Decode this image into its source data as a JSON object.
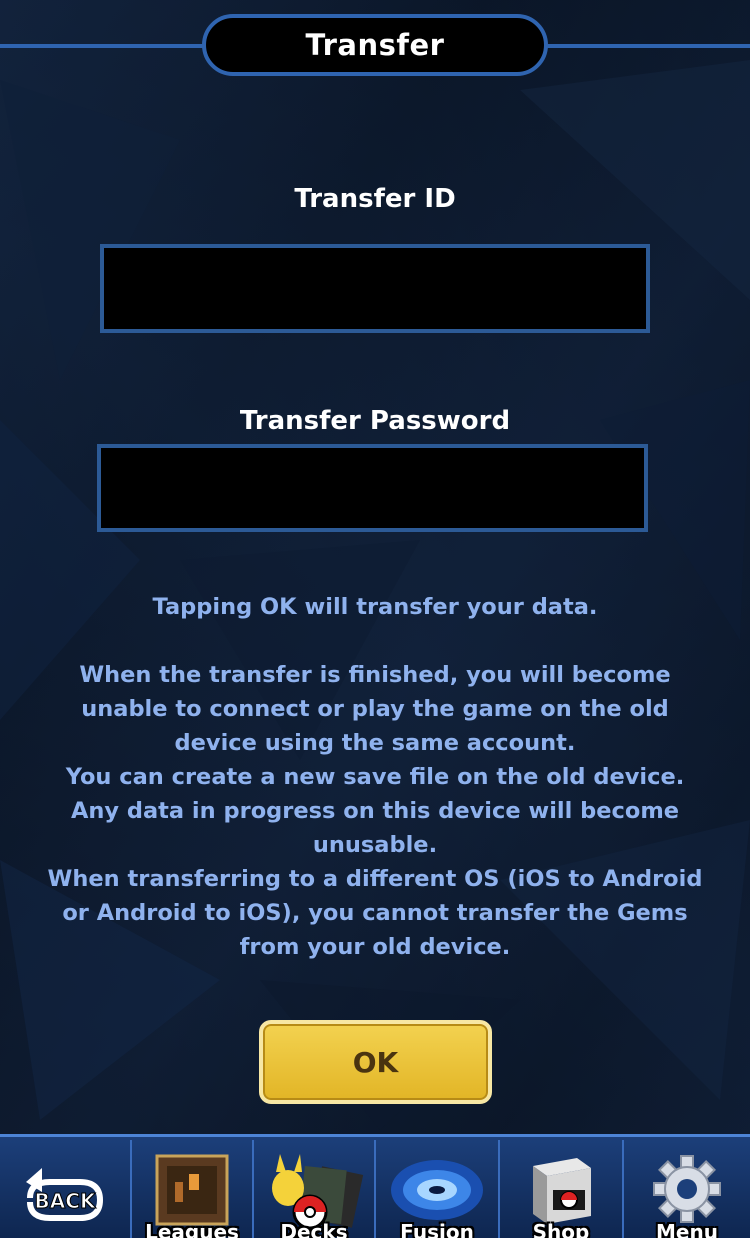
{
  "header": {
    "title": "Transfer"
  },
  "form": {
    "transfer_id_label": "Transfer ID",
    "transfer_id_value": "",
    "transfer_password_label": "Transfer Password",
    "transfer_password_value": ""
  },
  "info": {
    "line1": "Tapping OK will transfer your data.",
    "paragraph": [
      "When the transfer is finished, you will become",
      "unable to connect or play the game on the old",
      "device using the same account.",
      "You can create a new save file on the old device.",
      "Any data in progress on this device will become",
      "unusable.",
      "When transferring to a different OS (iOS to Android",
      "or Android to iOS), you cannot transfer the Gems",
      "from your old device."
    ]
  },
  "ok_button": {
    "label": "OK"
  },
  "nav": {
    "back_label": "BACK",
    "leagues_label": "Leagues",
    "decks_label": "Decks",
    "fusion_label": "Fusion",
    "shop_label": "Shop",
    "menu_label": "Menu"
  },
  "colors": {
    "accent_blue": "#2f64b0",
    "info_text": "#8fb2ee",
    "ok_button": "#f3d250"
  }
}
